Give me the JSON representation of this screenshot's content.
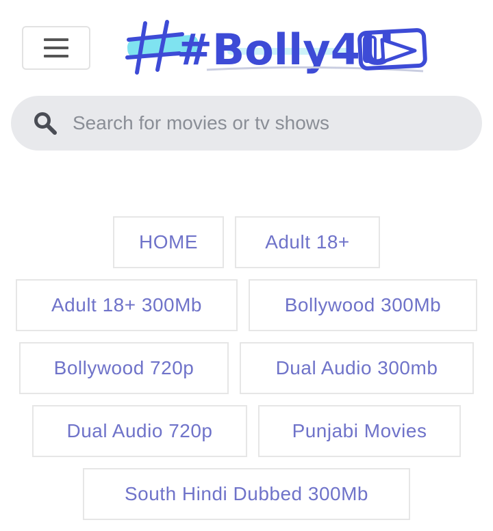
{
  "header": {
    "menu_icon": "hamburger-menu-icon",
    "logo": {
      "text": "#Bolly4U",
      "icon": "play-button-icon"
    }
  },
  "search": {
    "icon": "search-icon",
    "placeholder": "Search for movies or tv shows",
    "value": ""
  },
  "nav": {
    "rows": [
      [
        "HOME",
        "Adult 18+"
      ],
      [
        "Adult 18+ 300Mb",
        "Bollywood 300Mb"
      ],
      [
        "Bollywood 720p",
        "Dual Audio 300mb"
      ],
      [
        "Dual Audio 720p",
        "Punjabi Movies"
      ],
      [
        "South Hindi Dubbed 300Mb"
      ]
    ]
  },
  "colors": {
    "brand": "#3d4bd6",
    "logo_highlight": "#7fe3f0",
    "nav_text": "#6f73c9",
    "search_bg": "#e8e9ec"
  }
}
